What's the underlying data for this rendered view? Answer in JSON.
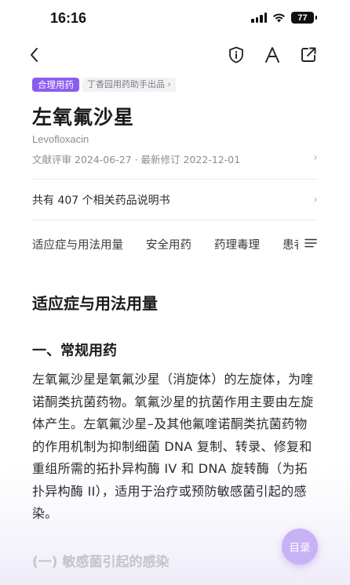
{
  "status": {
    "time": "16:16",
    "battery": "77"
  },
  "header": {
    "badge": "合理用药",
    "badge_sub": "丁香园用药助手出品 ›",
    "title": "左氧氟沙星",
    "english_name": "Levofloxacin",
    "review_info": "文献评审 2024-06-27 · 最新修订 2022-12-01",
    "chevron": "›"
  },
  "related": {
    "text": "共有 407 个相关药品说明书",
    "chevron": "›"
  },
  "tabs": [
    {
      "label": "适应症与用法用量"
    },
    {
      "label": "安全用药"
    },
    {
      "label": "药理毒理"
    },
    {
      "label": "患者"
    }
  ],
  "content": {
    "section_title": "适应症与用法用量",
    "subsection_title": "一、常规用药",
    "paragraph": "左氧氟沙星是氧氟沙星（消旋体）的左旋体，为喹诺酮类抗菌药物。氧氟沙星的抗菌作用主要由左旋体产生。左氧氟沙星–及其他氟喹诺酮类抗菌药物的作用机制为抑制细菌 DNA 复制、转录、修复和重组所需的拓扑异构酶 IV 和 DNA 旋转酶（为拓扑异构酶 II），适用于治疗或预防敏感菌引起的感染。",
    "next_title": "(一) 敏感菌引起的感染"
  },
  "toc_button": "目录",
  "colors": {
    "accent": "#8a5cf0",
    "toc": "#c7b2f6"
  }
}
